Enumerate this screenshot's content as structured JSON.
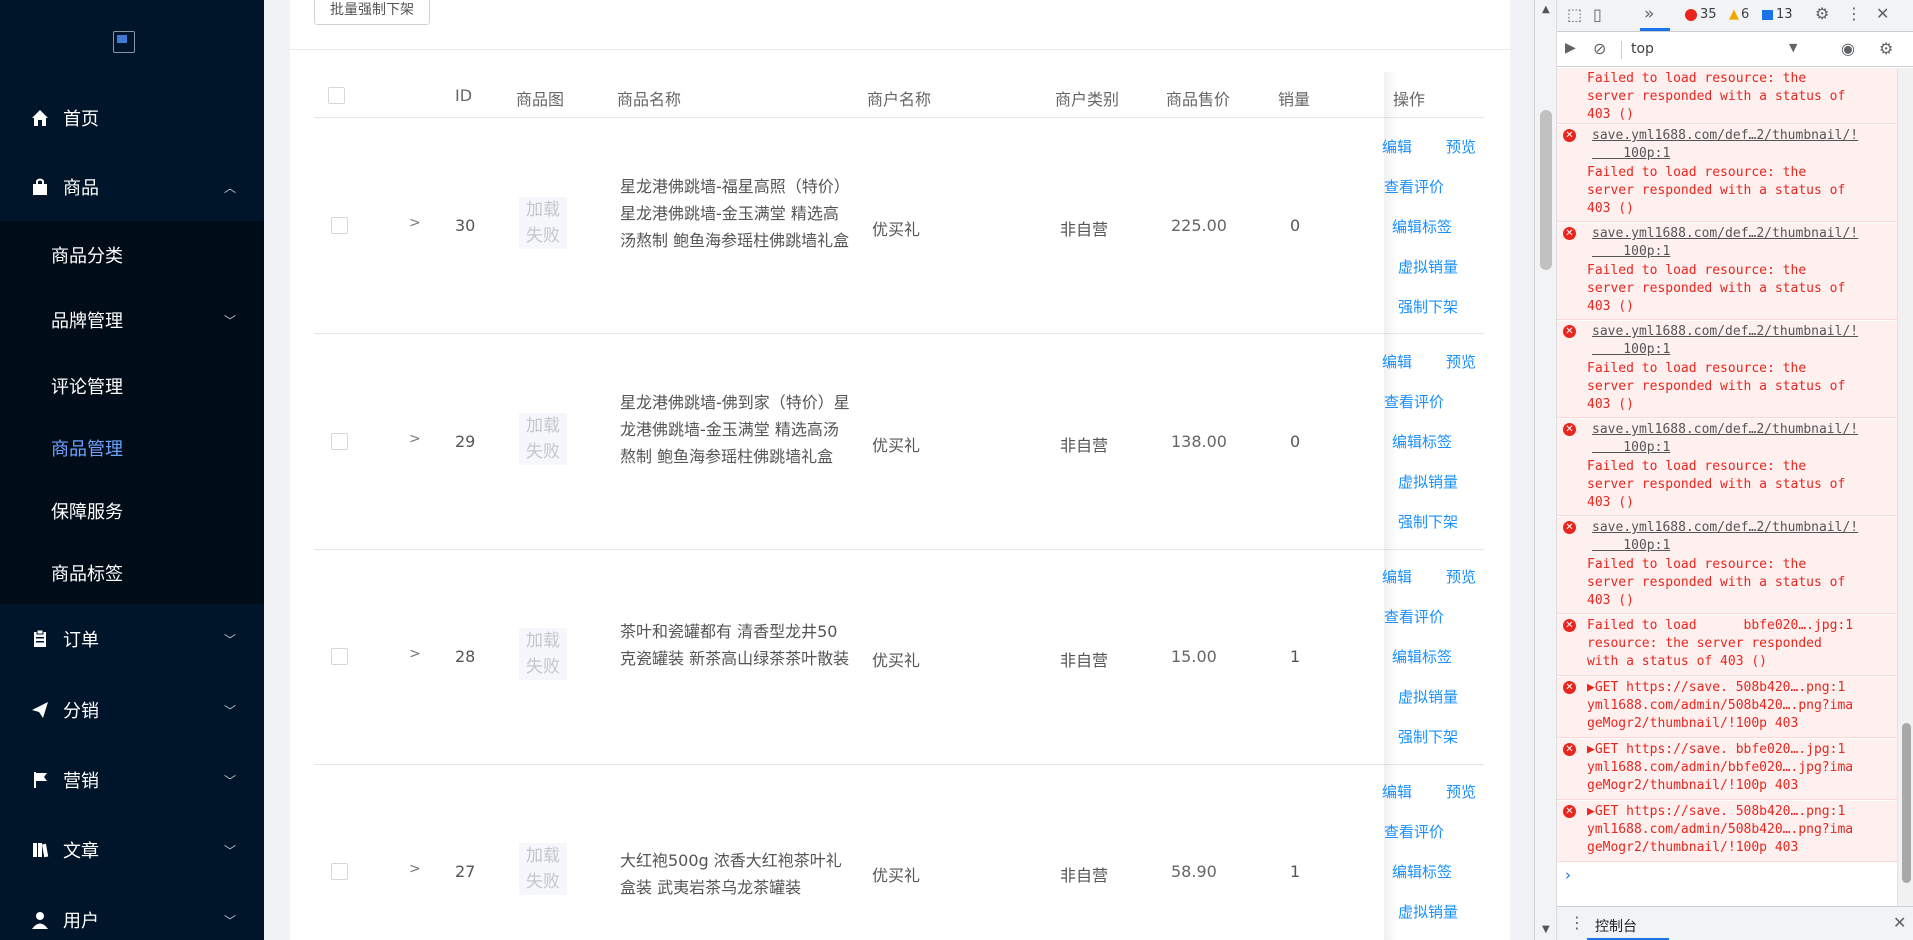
{
  "sidebar": {
    "menu": [
      {
        "label": "首页",
        "icon": "home-icon"
      },
      {
        "label": "商品",
        "icon": "shopping-bag-icon"
      },
      {
        "label": "订单",
        "icon": "clipboard-icon"
      },
      {
        "label": "分销",
        "icon": "send-icon"
      },
      {
        "label": "营销",
        "icon": "flag-icon"
      },
      {
        "label": "文章",
        "icon": "book-icon"
      },
      {
        "label": "用户",
        "icon": "user-icon"
      }
    ],
    "submenu": [
      {
        "label": "商品分类"
      },
      {
        "label": "品牌管理"
      },
      {
        "label": "评论管理"
      },
      {
        "label": "商品管理"
      },
      {
        "label": "保障服务"
      },
      {
        "label": "商品标签"
      }
    ]
  },
  "main": {
    "batch_button": "批量强制下架",
    "columns": [
      "ID",
      "商品图",
      "商品名称",
      "商户名称",
      "商户类别",
      "商品售价",
      "销量",
      "操作"
    ],
    "image_failed": "加载失败",
    "actions": {
      "edit": "编辑",
      "preview": "预览",
      "view_reviews": "查看评价",
      "edit_tags": "编辑标签",
      "virtual_sales": "虚拟销量",
      "force_delist": "强制下架"
    },
    "rows": [
      {
        "id": "30",
        "name": "星龙港佛跳墙-福星高照（特价）星龙港佛跳墙-金玉满堂 精选高汤熬制 鲍鱼海参瑶柱佛跳墙礼盒",
        "merchant": "优买礼",
        "merchant_type": "非自营",
        "price": "225.00",
        "sales": "0"
      },
      {
        "id": "29",
        "name": "星龙港佛跳墙-佛到家（特价）星龙港佛跳墙-金玉满堂 精选高汤熬制 鲍鱼海参瑶柱佛跳墙礼盒",
        "merchant": "优买礼",
        "merchant_type": "非自营",
        "price": "138.00",
        "sales": "0"
      },
      {
        "id": "28",
        "name": "茶叶和瓷罐都有 清香型龙井50克瓷罐装 新茶高山绿茶茶叶散装",
        "merchant": "优买礼",
        "merchant_type": "非自营",
        "price": "15.00",
        "sales": "1"
      },
      {
        "id": "27",
        "name": "大红袍500g 浓香大红袍茶叶礼盒装 武夷岩茶乌龙茶罐装",
        "merchant": "优买礼",
        "merchant_type": "非自营",
        "price": "58.90",
        "sales": "1"
      }
    ]
  },
  "devtools": {
    "error_count": "35",
    "warning_count": "6",
    "info_count": "13",
    "context": "top",
    "drawer_tab": "控制台",
    "messages": [
      {
        "text": "Failed to load resource: the\nserver responded with a status of\n403 ()",
        "link": ""
      },
      {
        "link": "save.yml1688.com/def…2/thumbnail/!\n    100p:1",
        "text": "Failed to load resource: the\nserver responded with a status of\n403 ()"
      },
      {
        "link": "save.yml1688.com/def…2/thumbnail/!\n    100p:1",
        "text": "Failed to load resource: the\nserver responded with a status of\n403 ()"
      },
      {
        "link": "save.yml1688.com/def…2/thumbnail/!\n    100p:1",
        "text": "Failed to load resource: the\nserver responded with a status of\n403 ()"
      },
      {
        "link": "save.yml1688.com/def…2/thumbnail/!\n    100p:1",
        "text": "Failed to load resource: the\nserver responded with a status of\n403 ()"
      },
      {
        "link": "save.yml1688.com/def…2/thumbnail/!\n    100p:1",
        "text": "Failed to load resource: the\nserver responded with a status of\n403 ()"
      },
      {
        "text": "Failed to load      bbfe020….jpg:1\nresource: the server responded\nwith a status of 403 ()",
        "link": ""
      },
      {
        "text": "▶GET https://save. 508b420….png:1\nyml1688.com/admin/508b420….png?ima\ngeMogr2/thumbnail/!100p 403",
        "link": ""
      },
      {
        "text": "▶GET https://save. bbfe020….jpg:1\nyml1688.com/admin/bbfe020….jpg?ima\ngeMogr2/thumbnail/!100p 403",
        "link": ""
      },
      {
        "text": "▶GET https://save. 508b420….png:1\nyml1688.com/admin/508b420….png?ima\ngeMogr2/thumbnail/!100p 403",
        "link": ""
      }
    ]
  },
  "colors": {
    "sidebar": "#001529",
    "submenu": "#000c17",
    "active": "#6ba4ff",
    "link": "#1890ff",
    "error": "#e8261e"
  }
}
